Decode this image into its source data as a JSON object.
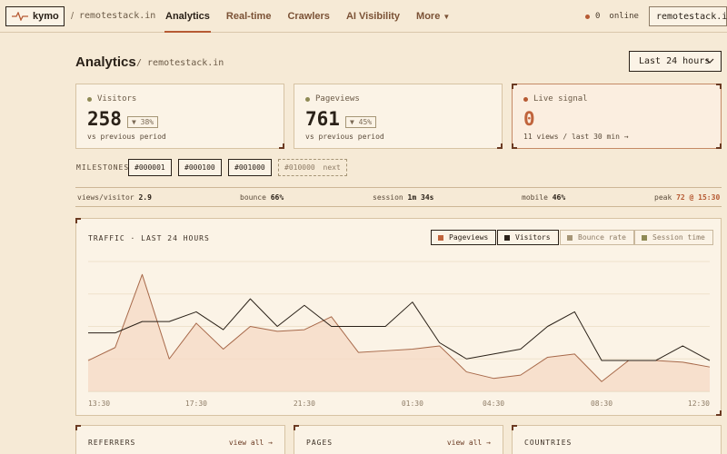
{
  "nav": {
    "brand": "kymo",
    "site": "remotestack.in",
    "links": [
      "Analytics",
      "Real-time",
      "Crawlers",
      "AI Visibility",
      "More"
    ],
    "online_count": "0",
    "online_label": "online",
    "site_selector": "remotestack.in"
  },
  "header": {
    "title": "Analytics",
    "subtitle": "/ remotestack.in",
    "range": "Last 24 hours"
  },
  "cards": [
    {
      "label": "Visitors",
      "value": "258",
      "delta": "▼ 38%",
      "note": "vs previous period"
    },
    {
      "label": "Pageviews",
      "value": "761",
      "delta": "▼ 45%",
      "note": "vs previous period"
    },
    {
      "label": "Live signal",
      "value": "0",
      "note": "11 views / last 30 min →"
    }
  ],
  "milestones": {
    "label": "MILESTONES",
    "items": [
      "#000001",
      "#000100",
      "#001000"
    ],
    "next_value": "#010000",
    "next_label": "next"
  },
  "metrics": {
    "views_per_visitor_label": "views/visitor",
    "views_per_visitor": "2.9",
    "bounce_label": "bounce",
    "bounce": "66%",
    "session_label": "session",
    "session": "1m 34s",
    "mobile_label": "mobile",
    "mobile": "46%",
    "peak_label": "peak",
    "peak": "72 @ 15:30"
  },
  "chart": {
    "title": "TRAFFIC · LAST 24 HOURS",
    "legend": [
      "Pageviews",
      "Visitors",
      "Bounce rate",
      "Session time"
    ],
    "colors": {
      "pageviews": "#c0643c",
      "visitors": "#2a2118",
      "bounce": "#a69677",
      "session": "#8f8a55"
    }
  },
  "chart_data": {
    "type": "line",
    "x": [
      "13:30",
      "14:30",
      "15:30",
      "16:30",
      "17:30",
      "18:30",
      "19:30",
      "20:30",
      "21:30",
      "22:30",
      "23:30",
      "00:30",
      "01:30",
      "02:30",
      "03:30",
      "04:30",
      "05:30",
      "06:30",
      "07:30",
      "08:30",
      "09:30",
      "10:30",
      "11:30",
      "12:30"
    ],
    "x_tick_labels": [
      "13:30",
      "17:30",
      "21:30",
      "01:30",
      "04:30",
      "08:30",
      "12:30"
    ],
    "series": [
      {
        "name": "Pageviews",
        "values": [
          19,
          27,
          72,
          20,
          42,
          26,
          40,
          37,
          38,
          46,
          24,
          25,
          26,
          28,
          12,
          8,
          10,
          21,
          23,
          6,
          19,
          19,
          18,
          15
        ]
      },
      {
        "name": "Visitors",
        "values": [
          36,
          36,
          43,
          43,
          49,
          38,
          57,
          40,
          53,
          40,
          40,
          40,
          55,
          30,
          20,
          23,
          26,
          40,
          49,
          19,
          19,
          19,
          28,
          19
        ]
      }
    ],
    "ylim": [
      0,
      80
    ],
    "grid": true
  },
  "panels": [
    {
      "title": "REFERRERS",
      "link": "view all →"
    },
    {
      "title": "PAGES",
      "link": "view all →"
    },
    {
      "title": "COUNTRIES",
      "link": ""
    }
  ]
}
